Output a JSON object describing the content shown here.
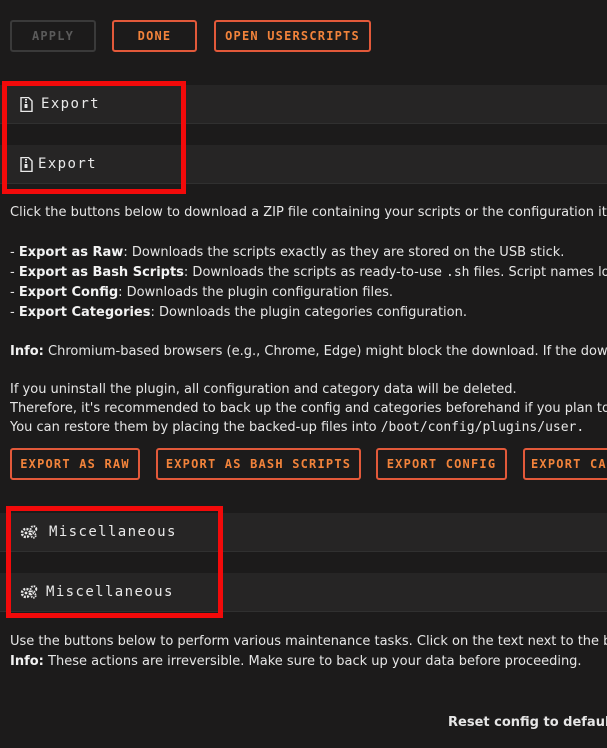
{
  "toolbar": {
    "apply_label": "APPLY",
    "done_label": "DONE",
    "open_userscripts_label": "OPEN USERSCRIPTS"
  },
  "export_section": {
    "title_1": "Export",
    "title_2": "Export",
    "icon": "file-zip-icon",
    "intro": "Click the buttons below to download a ZIP file containing your scripts or the configuration its",
    "items": [
      {
        "term": "Export as Raw",
        "desc": ": Downloads the scripts exactly as they are stored on the USB stick."
      },
      {
        "term": "Export as Bash Scripts",
        "desc": ": Downloads the scripts as ready-to-use ",
        "code": ".sh",
        "desc2": " files. Script names long"
      },
      {
        "term": "Export Config",
        "desc": ": Downloads the plugin configuration files."
      },
      {
        "term": "Export Categories",
        "desc": ": Downloads the plugin categories configuration."
      }
    ],
    "info_label": "Info:",
    "info_text": " Chromium-based browsers (e.g., Chrome, Edge) might block the download. If the downl",
    "uninstall_1": "If you uninstall the plugin, all configuration and category data will be deleted.",
    "uninstall_2": "Therefore, it's recommended to back up the config and categories beforehand if you plan to r",
    "uninstall_3": "You can restore them by placing the backed-up files into ",
    "uninstall_path": "/boot/config/plugins/user.",
    "buttons": {
      "raw": "EXPORT AS RAW",
      "bash": "EXPORT AS BASH SCRIPTS",
      "config": "EXPORT CONFIG",
      "categories": "EXPORT CA"
    }
  },
  "misc_section": {
    "title_1": "Miscellaneous",
    "title_2": "Miscellaneous",
    "icon": "gears-icon",
    "text_1": "Use the buttons below to perform various maintenance tasks. Click on the text next to the bu",
    "info_label": "Info:",
    "info_text": " These actions are irreversible. Make sure to back up your data before proceeding.",
    "reset_label": "Reset config to default:"
  },
  "colors": {
    "accent_border": "#e2593a",
    "accent_text": "#f2833b",
    "highlight_box": "#f20a0a",
    "background": "#1c1b1b"
  }
}
